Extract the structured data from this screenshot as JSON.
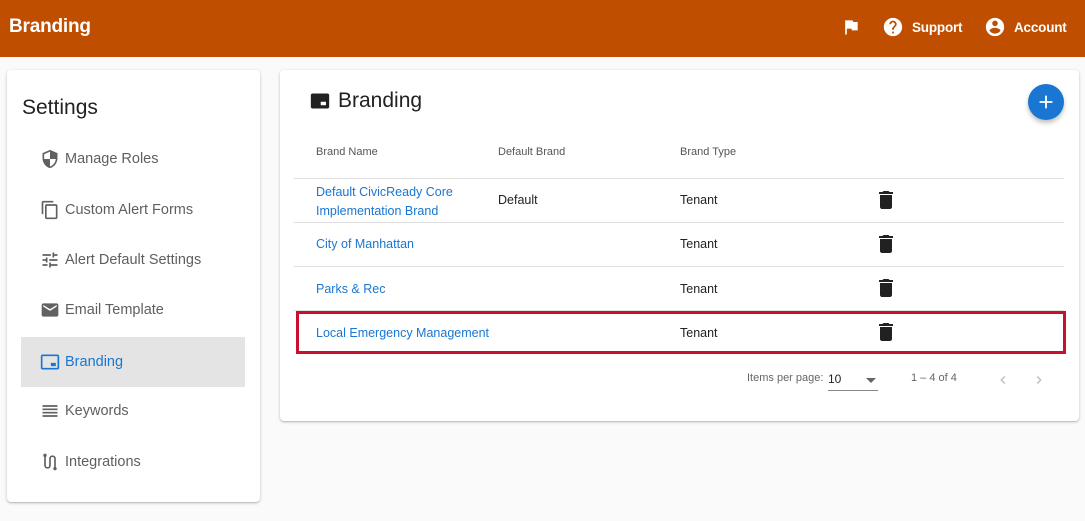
{
  "header": {
    "title": "Branding",
    "support_label": "Support",
    "account_label": "Account"
  },
  "sidebar": {
    "title": "Settings",
    "items": [
      {
        "label": "Manage Roles",
        "icon": "shield-icon"
      },
      {
        "label": "Custom Alert Forms",
        "icon": "copy-icon"
      },
      {
        "label": "Alert Default Settings",
        "icon": "tune-icon"
      },
      {
        "label": "Email Template",
        "icon": "mail-icon"
      },
      {
        "label": "Branding",
        "icon": "branding-icon",
        "active": true
      },
      {
        "label": "Keywords",
        "icon": "list-icon"
      },
      {
        "label": "Integrations",
        "icon": "integration-icon"
      }
    ]
  },
  "main": {
    "title": "Branding",
    "columns": [
      "Brand Name",
      "Default Brand",
      "Brand Type"
    ],
    "rows": [
      {
        "name": "Default CivicReady Core Implementation Brand",
        "default": "Default",
        "type": "Tenant"
      },
      {
        "name": "City of Manhattan",
        "default": "",
        "type": "Tenant"
      },
      {
        "name": "Parks & Rec",
        "default": "",
        "type": "Tenant"
      },
      {
        "name": "Local Emergency Management",
        "default": "",
        "type": "Tenant"
      }
    ],
    "paginator": {
      "items_per_page_label": "Items per page:",
      "items_per_page": "10",
      "range": "1 – 4 of 4"
    }
  },
  "colors": {
    "header_bg": "#bf4e00",
    "accent": "#1976d2",
    "highlight": "#c8102e"
  }
}
